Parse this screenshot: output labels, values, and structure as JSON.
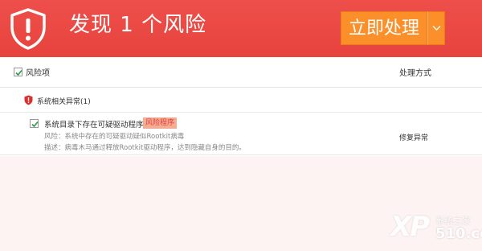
{
  "header": {
    "title": "发现 1 个风险",
    "action_label": "立即处理",
    "shield_icon": "shield-exclamation-icon",
    "dropdown_icon": "chevron-down-icon"
  },
  "columns": {
    "risk_item": "风险项",
    "method": "处理方式"
  },
  "group": {
    "label": "系统相关异常(1)"
  },
  "items": [
    {
      "title": "系统目录下存在可疑驱动程序",
      "tag": "风险程序",
      "risk": "风险：系统中存在的可疑驱动疑似Rootkit病毒",
      "desc": "描述：病毒木马通过释放Rootkit驱动程序，达到隐藏自身的目的。",
      "action": "修复异常",
      "checked": true
    }
  ],
  "watermark": {
    "logo": "XP",
    "site": "系统之家",
    "number": "510.com"
  },
  "colors": {
    "header_red": "#e94843",
    "button_orange": "#fb8f2a",
    "tag_bg": "#f4ad95",
    "tag_text": "#e0403a",
    "lower_bg": "#fdf3f3"
  }
}
